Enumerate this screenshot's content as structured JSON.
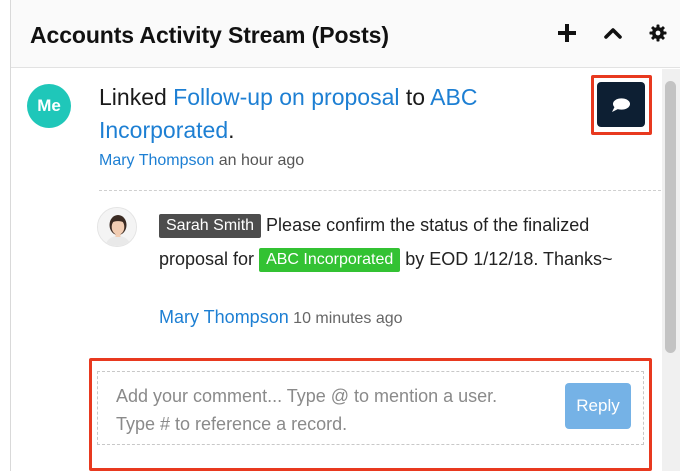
{
  "dashlet": {
    "title": "Accounts Activity Stream (Posts)",
    "actions": [
      "plus-icon",
      "collapse-icon",
      "gear-icon"
    ]
  },
  "post": {
    "avatar_initials": "Me",
    "avatar_color": "#1fc7b9",
    "prefix": "Linked ",
    "link1": "Follow-up on proposal",
    "middle": " to ",
    "link2": "ABC Incorporated",
    "suffix": ".",
    "author": "Mary Thompson",
    "time": " an hour ago",
    "comment_icon": "comment-icon"
  },
  "reply": {
    "mention": "Sarah Smith",
    "text1": " Please confirm the status of the finalized proposal for ",
    "record": "ABC Incorporated",
    "text2": " by EOD 1/12/18. Thanks~",
    "author": "Mary Thompson",
    "time": " 10 minutes ago"
  },
  "comment_form": {
    "placeholder": "Add your comment... Type @ to mention a user. Type # to reference a record.",
    "reply_label": "Reply"
  },
  "colors": {
    "link": "#1d7fd3",
    "highlight": "#e8391f",
    "mention_pill": "#4d4d4d",
    "record_pill": "#33c233",
    "reply_button": "#75b2e6",
    "comment_button": "#0d1f33"
  }
}
